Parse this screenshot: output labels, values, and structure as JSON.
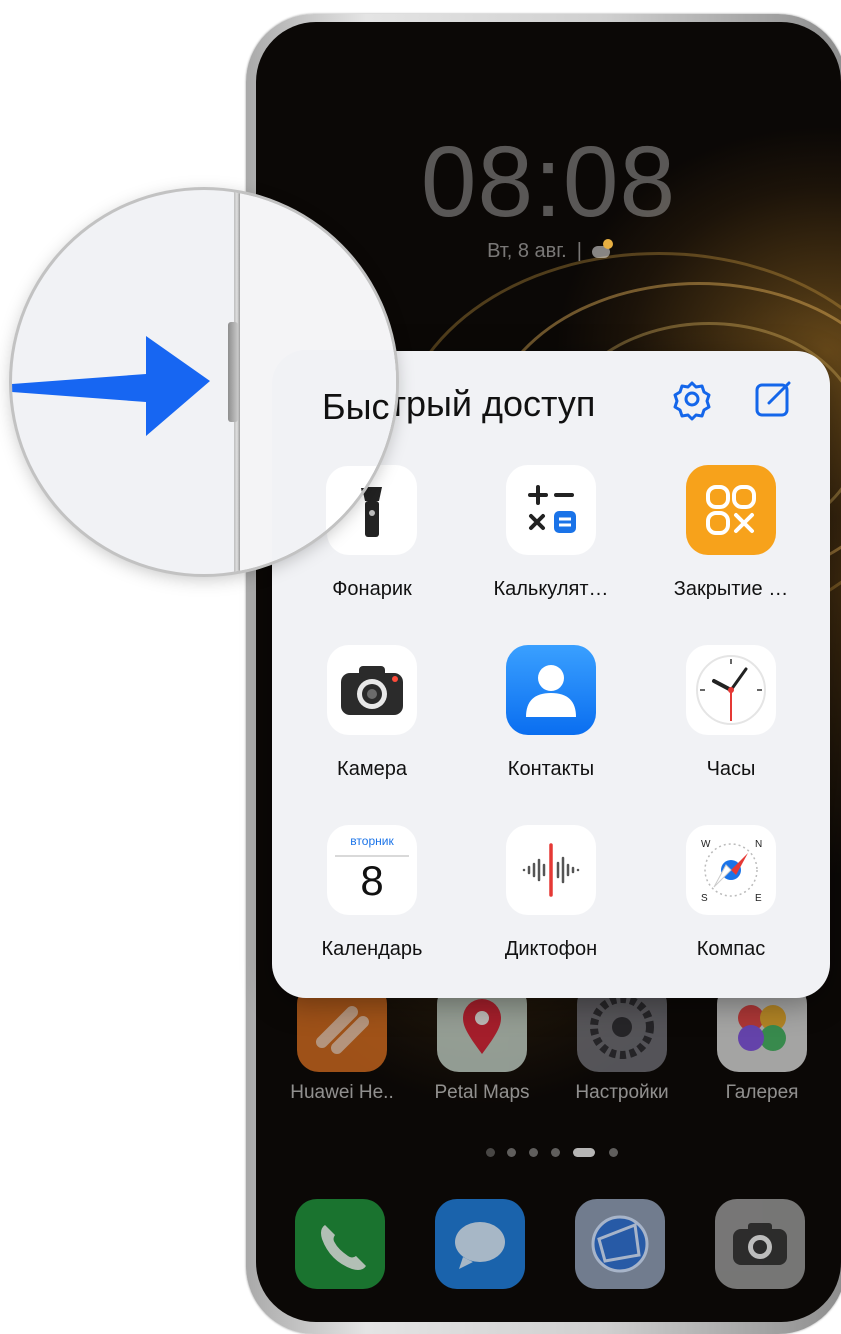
{
  "lock_screen": {
    "time": "08:08",
    "date": "Вт, 8 авг.",
    "separator": "|"
  },
  "quick_access": {
    "title": "Быстрый доступ",
    "lens_title_fragment": "Быс",
    "apps": [
      {
        "label": "Фонарик",
        "icon": "flashlight-icon"
      },
      {
        "label": "Калькулят…",
        "icon": "calculator-icon"
      },
      {
        "label": "Закрытие …",
        "icon": "close-apps-icon"
      },
      {
        "label": "Камера",
        "icon": "camera-icon"
      },
      {
        "label": "Контакты",
        "icon": "contacts-icon"
      },
      {
        "label": "Часы",
        "icon": "clock-icon"
      },
      {
        "label": "Календарь",
        "icon": "calendar-icon",
        "weekday": "вторник",
        "day": "8"
      },
      {
        "label": "Диктофон",
        "icon": "recorder-icon"
      },
      {
        "label": "Компас",
        "icon": "compass-icon",
        "n": "N",
        "s": "S",
        "e": "E",
        "w": "W"
      }
    ]
  },
  "home_screen": {
    "apps": [
      {
        "label": "Huawei He..",
        "icon": "huawei-health-icon"
      },
      {
        "label": "Petal Maps",
        "icon": "petal-maps-icon"
      },
      {
        "label": "Настройки",
        "icon": "settings-icon"
      },
      {
        "label": "Галерея",
        "icon": "gallery-icon"
      }
    ],
    "dock": [
      {
        "icon": "phone-icon"
      },
      {
        "icon": "messages-icon"
      },
      {
        "icon": "browser-icon"
      },
      {
        "icon": "camera-icon"
      }
    ],
    "active_page_index": 4
  },
  "colors": {
    "arrow": "#1766f2",
    "calculator_accent": "#1a73e8",
    "close_apps_bg": "#f7a21b",
    "contacts_bg": "#2288ff",
    "clock_second_hand": "#e53935"
  }
}
